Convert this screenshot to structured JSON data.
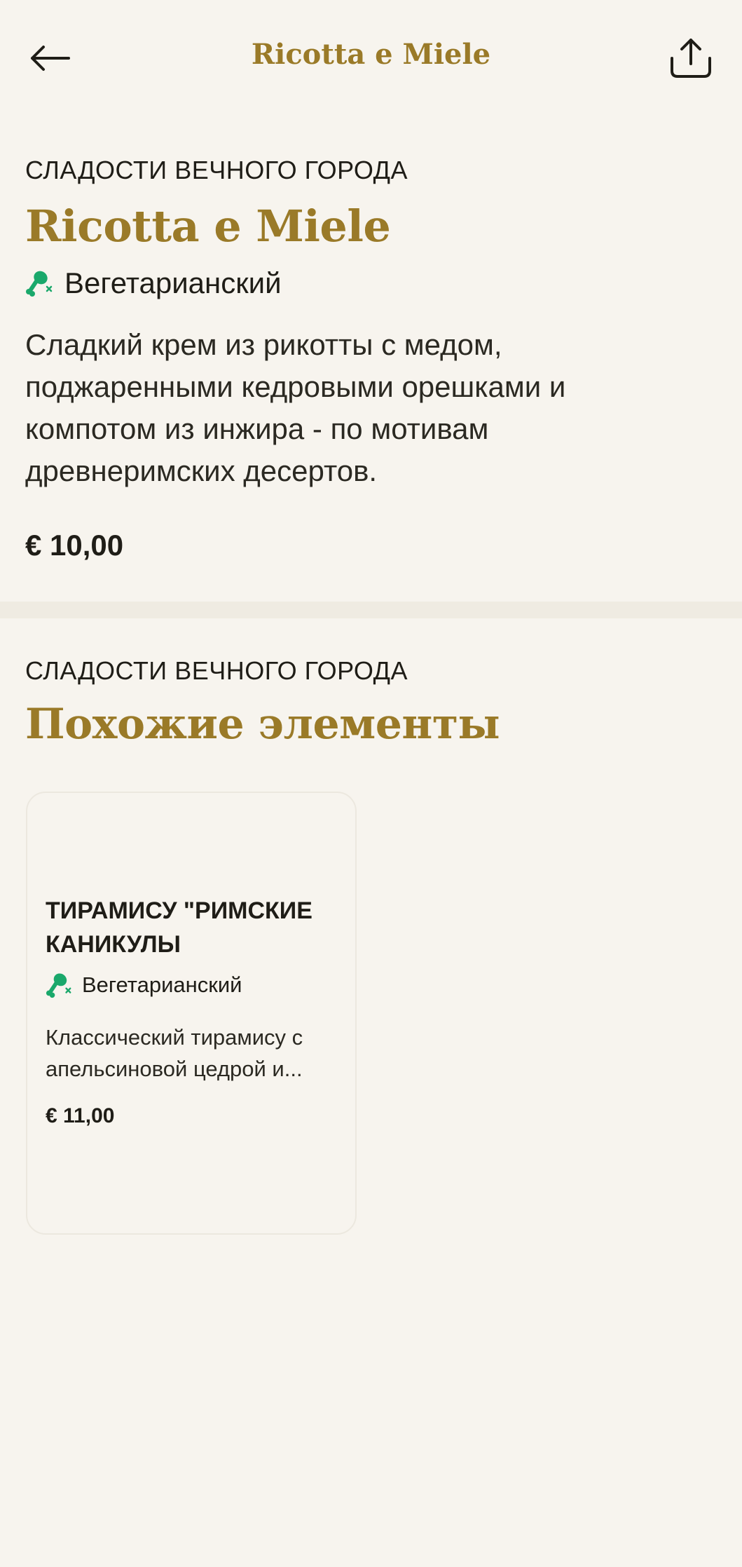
{
  "header": {
    "title": "Ricotta e Miele",
    "back_icon": "arrow-left-icon",
    "share_icon": "share-icon"
  },
  "item": {
    "category": "СЛАДОСТИ ВЕЧНОГО ГОРОДА",
    "name": "Ricotta e Miele",
    "diet_label": "Вегетарианский",
    "diet_icon": "vegetarian-drumstick-icon",
    "description": "Сладкий крем из рикотты с медом, поджаренными кедровыми орешками и компотом из инжира - по мотивам древнеримских десертов.",
    "price": "€ 10,00"
  },
  "similar": {
    "category": "СЛАДОСТИ ВЕЧНОГО ГОРОДА",
    "heading": "Похожие элементы",
    "items": [
      {
        "name": "ТИРАМИСУ \"РИМСКИЕ КАНИКУЛЫ",
        "diet_label": "Вегетарианский",
        "description": "Классический тирамису с апельсиновой цедрой и...",
        "price": "€ 11,00"
      }
    ]
  },
  "colors": {
    "background": "#f7f4ee",
    "accent_gold": "#9a7a28",
    "diet_green": "#1aa86b",
    "text_dark": "#1f1d17"
  }
}
